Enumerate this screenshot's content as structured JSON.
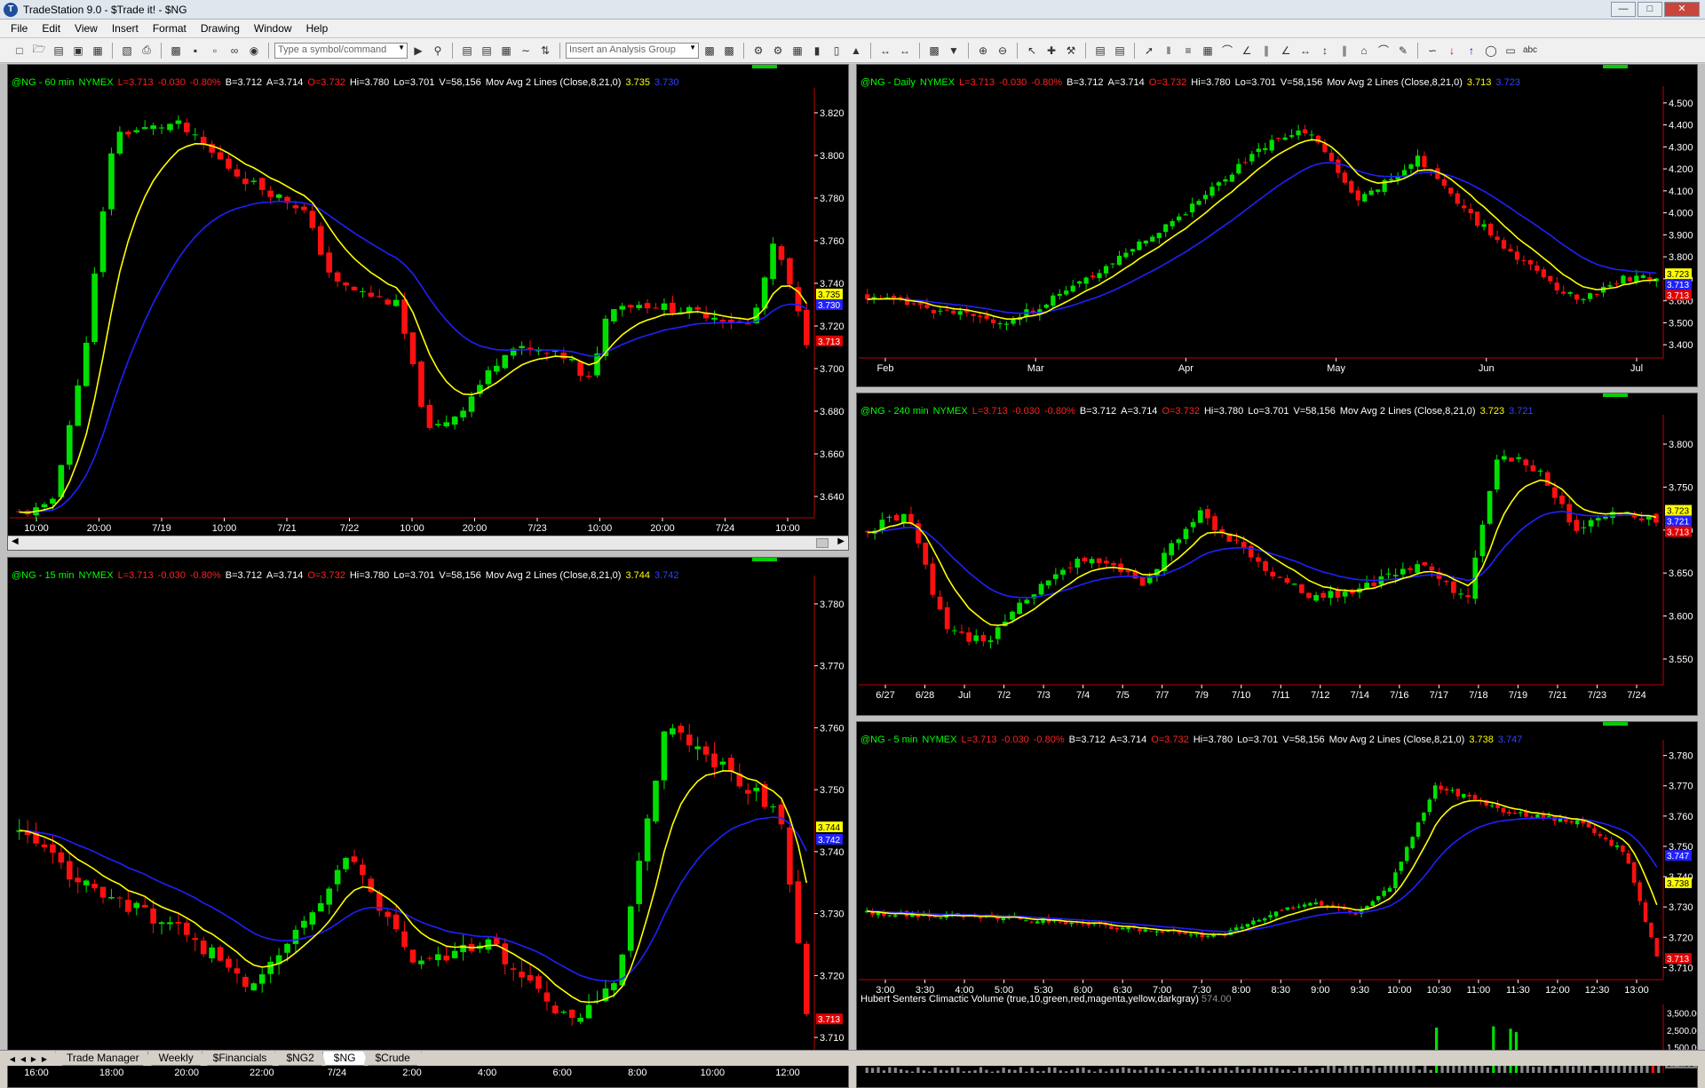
{
  "titlebar": {
    "title": "TradeStation 9.0 - $Trade it! - $NG",
    "app_icon": "tradestation-logo",
    "buttons": {
      "minimize": "minimize-icon",
      "maximize": "maximize-icon",
      "close": "close-icon"
    }
  },
  "menus": [
    "File",
    "Edit",
    "View",
    "Insert",
    "Format",
    "Drawing",
    "Window",
    "Help"
  ],
  "toolbar": {
    "symbol_placeholder": "Type a symbol/command",
    "analysis_placeholder": "Insert an Analysis Group",
    "abc_label": "abc"
  },
  "colors": {
    "up": "#00e000",
    "down": "#ff1010",
    "fast_avg": "#ffff00",
    "slow_avg": "#2020ff",
    "background": "#000000",
    "axis": "#ffffff"
  },
  "charts": [
    {
      "id": "ng60",
      "header": {
        "symbol": "@NG - 60 min",
        "exchange": "NYMEX",
        "last": "L=3.713",
        "chg": "-0.030",
        "pct": "-0.80%",
        "bid": "B=3.712",
        "ask": "A=3.714",
        "open": "O=3.732",
        "hi": "Hi=3.780",
        "lo": "Lo=3.701",
        "vol": "V=58,156",
        "study": "Mov Avg 2 Lines (Close,8,21,0)",
        "fast": "3.735",
        "slow": "3.730"
      },
      "price_ticks": [
        "3.820",
        "3.800",
        "3.780",
        "3.760",
        "3.740",
        "3.720",
        "3.700",
        "3.680",
        "3.660",
        "3.640"
      ],
      "time_ticks": [
        "10:00",
        "20:00",
        "7/19",
        "10:00",
        "7/21",
        "7/22",
        "10:00",
        "20:00",
        "7/23",
        "10:00",
        "20:00",
        "7/24",
        "10:00"
      ],
      "last_fast": "3.735",
      "last_slow": "3.730",
      "last_price": "3.713"
    },
    {
      "id": "ngdaily",
      "header": {
        "symbol": "@NG - Daily",
        "exchange": "NYMEX",
        "last": "L=3.713",
        "chg": "-0.030",
        "pct": "-0.80%",
        "bid": "B=3.712",
        "ask": "A=3.714",
        "open": "O=3.732",
        "hi": "Hi=3.780",
        "lo": "Lo=3.701",
        "vol": "V=58,156",
        "study": "Mov Avg 2 Lines (Close,8,21,0)",
        "fast": "3.713",
        "slow": "3.723"
      },
      "price_ticks": [
        "4.500",
        "4.400",
        "4.300",
        "4.200",
        "4.100",
        "4.000",
        "3.900",
        "3.800",
        "3.700",
        "3.600",
        "3.500",
        "3.400"
      ],
      "time_ticks": [
        "Feb",
        "Mar",
        "Apr",
        "May",
        "Jun",
        "Jul"
      ],
      "last_fast": "3.723",
      "last_slow": "3.713",
      "last_price": "3.713"
    },
    {
      "id": "ng15",
      "header": {
        "symbol": "@NG - 15 min",
        "exchange": "NYMEX",
        "last": "L=3.713",
        "chg": "-0.030",
        "pct": "-0.80%",
        "bid": "B=3.712",
        "ask": "A=3.714",
        "open": "O=3.732",
        "hi": "Hi=3.780",
        "lo": "Lo=3.701",
        "vol": "V=58,156",
        "study": "Mov Avg 2 Lines (Close,8,21,0)",
        "fast": "3.744",
        "slow": "3.742"
      },
      "price_ticks": [
        "3.780",
        "3.770",
        "3.760",
        "3.750",
        "3.740",
        "3.730",
        "3.720",
        "3.710"
      ],
      "time_ticks": [
        "16:00",
        "18:00",
        "20:00",
        "22:00",
        "7/24",
        "2:00",
        "4:00",
        "6:00",
        "8:00",
        "10:00",
        "12:00"
      ],
      "last_fast": "3.744",
      "last_slow": "3.742",
      "last_price": "3.713"
    },
    {
      "id": "ng240",
      "header": {
        "symbol": "@NG - 240 min",
        "exchange": "NYMEX",
        "last": "L=3.713",
        "chg": "-0.030",
        "pct": "-0.80%",
        "bid": "B=3.712",
        "ask": "A=3.714",
        "open": "O=3.732",
        "hi": "Hi=3.780",
        "lo": "Lo=3.701",
        "vol": "V=58,156",
        "study": "Mov Avg 2 Lines (Close,8,21,0)",
        "fast": "3.723",
        "slow": "3.721"
      },
      "price_ticks": [
        "3.800",
        "3.750",
        "3.700",
        "3.650",
        "3.600",
        "3.550"
      ],
      "time_ticks": [
        "6/27",
        "6/28",
        "Jul",
        "7/2",
        "7/3",
        "7/4",
        "7/5",
        "7/7",
        "7/9",
        "7/10",
        "7/11",
        "7/12",
        "7/14",
        "7/16",
        "7/17",
        "7/18",
        "7/19",
        "7/21",
        "7/23",
        "7/24"
      ],
      "last_fast": "3.723",
      "last_slow": "3.721",
      "last_price": "3.713"
    },
    {
      "id": "ng5",
      "header": {
        "symbol": "@NG - 5 min",
        "exchange": "NYMEX",
        "last": "L=3.713",
        "chg": "-0.030",
        "pct": "-0.80%",
        "bid": "B=3.712",
        "ask": "A=3.714",
        "open": "O=3.732",
        "hi": "Hi=3.780",
        "lo": "Lo=3.701",
        "vol": "V=58,156",
        "study": "Mov Avg 2 Lines (Close,8,21,0)",
        "fast": "3.738",
        "slow": "3.747"
      },
      "price_ticks": [
        "3.780",
        "3.770",
        "3.760",
        "3.750",
        "3.740",
        "3.730",
        "3.720",
        "3.710"
      ],
      "time_ticks": [
        "3:00",
        "3:30",
        "4:00",
        "5:00",
        "5:30",
        "6:00",
        "6:30",
        "7:00",
        "7:30",
        "8:00",
        "8:30",
        "9:00",
        "9:30",
        "10:00",
        "10:30",
        "11:00",
        "11:30",
        "12:00",
        "12:30",
        "13:00"
      ],
      "last_fast": "3.738",
      "last_slow": "3.747",
      "last_price": "3.713",
      "indicator": {
        "label": "Hubert Senters Climactic Volume (true,10,green,red,magenta,yellow,darkgray)",
        "value": "574.00",
        "ticks": [
          "3,500.00",
          "2,500.00",
          "1,500.00",
          "574.00"
        ]
      }
    }
  ],
  "sheet_tabs": [
    "Trade Manager",
    "Weekly",
    "$Financials",
    "$NG2",
    "$NG",
    "$Crude"
  ],
  "active_tab": "$NG"
}
